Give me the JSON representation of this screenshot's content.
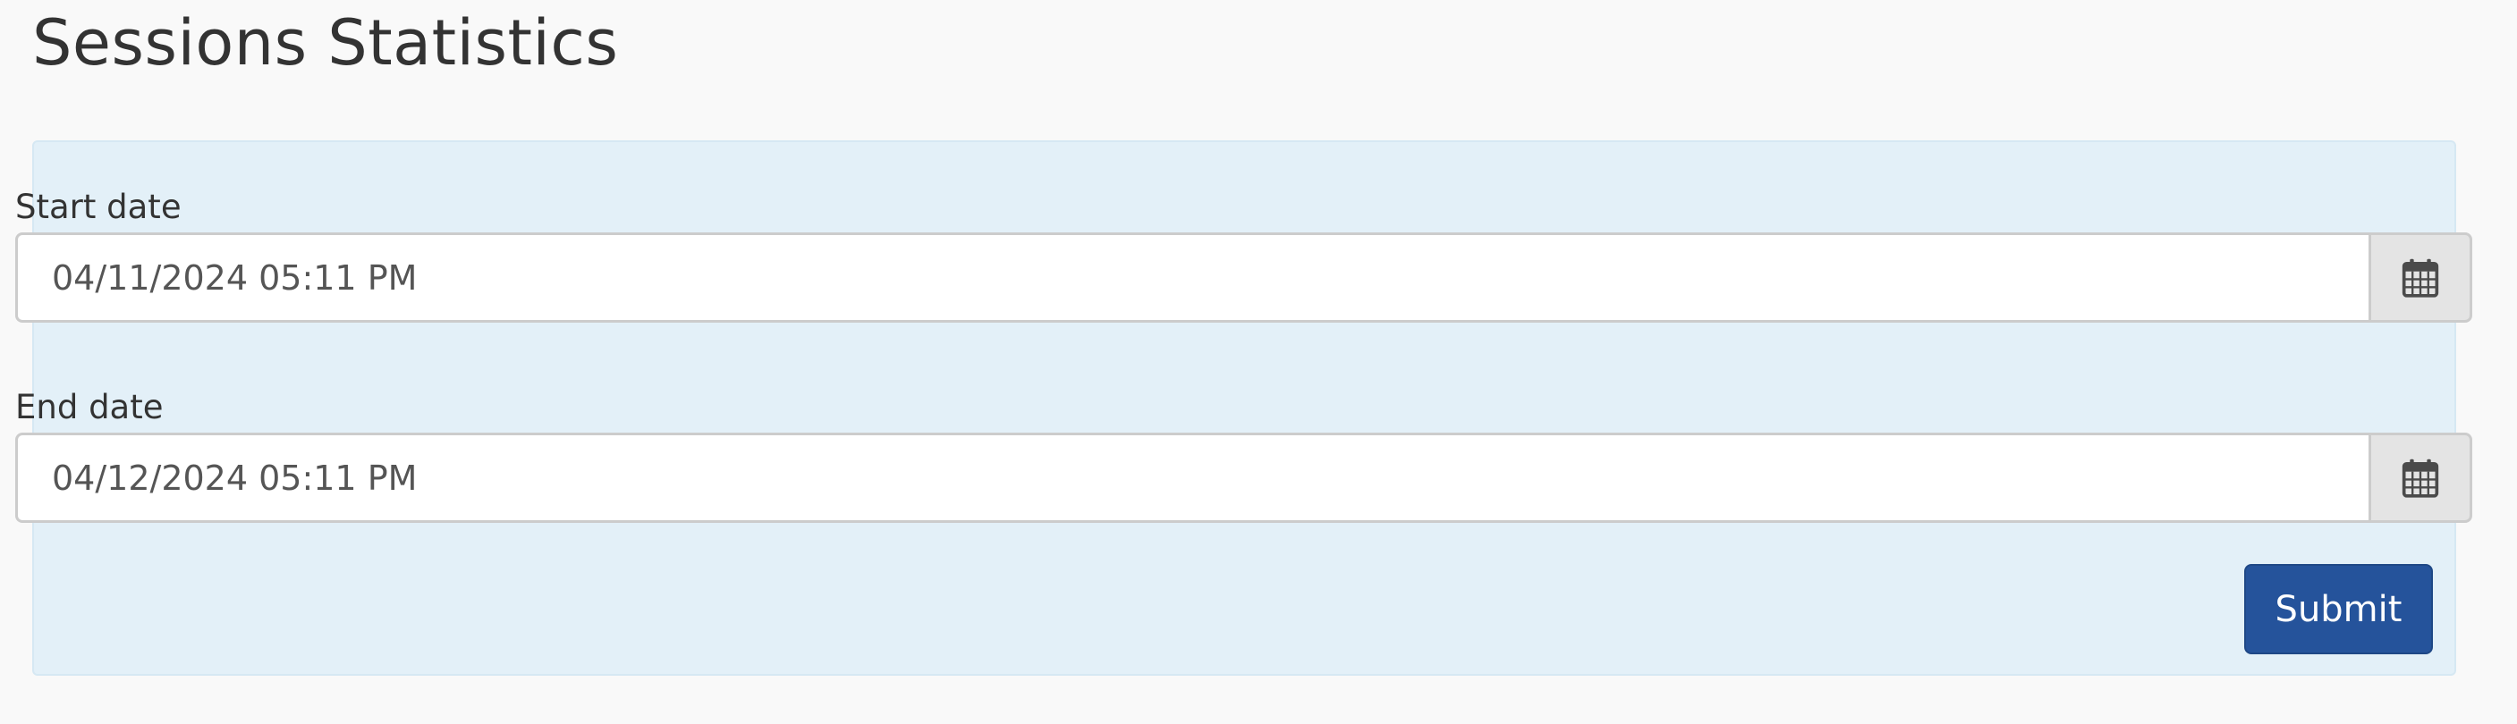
{
  "page": {
    "title": "Sessions Statistics"
  },
  "form": {
    "start_date": {
      "label": "Start date",
      "value": "04/11/2024 05:11 PM",
      "icon": "calendar-icon"
    },
    "end_date": {
      "label": "End date",
      "value": "04/12/2024 05:11 PM",
      "icon": "calendar-icon"
    },
    "submit_label": "Submit"
  },
  "colors": {
    "page_background": "#f9f9f9",
    "panel_background": "#e3f0f8",
    "submit_button": "#25539b",
    "addon_background": "#e4e4e4"
  }
}
